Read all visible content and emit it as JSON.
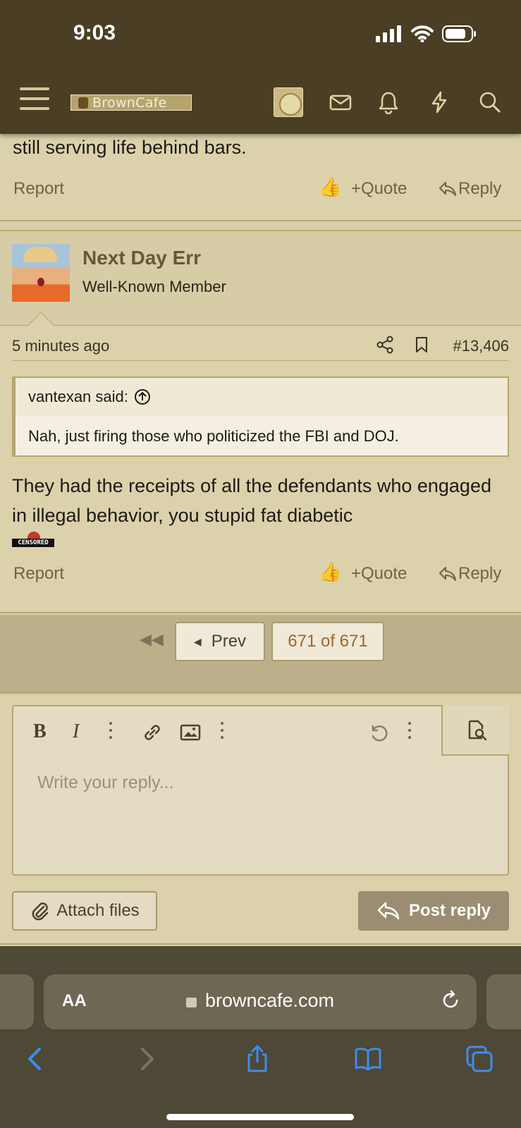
{
  "status_bar": {
    "time": "9:03"
  },
  "header": {
    "logo_text": "BrownCafe"
  },
  "prev_post": {
    "text_tail": "still serving life behind bars.",
    "report_label": "Report",
    "quote_label": "Quote",
    "reply_label": "Reply"
  },
  "post": {
    "username": "Next Day Err",
    "user_title": "Well-Known Member",
    "time": "5 minutes ago",
    "post_number": "#13,406",
    "quote": {
      "author_said": "vantexan said:",
      "body": "Nah, just firing those who politicized the FBI and DOJ."
    },
    "body": "They had the receipts of all the defendants who engaged in illegal behavior, you stupid fat diabetic",
    "censored_label": "CENSORED",
    "report_label": "Report",
    "quote_label": "Quote",
    "reply_label": "Reply"
  },
  "pager": {
    "prev_label": "Prev",
    "page_label": "671 of 671"
  },
  "editor": {
    "placeholder": "Write your reply...",
    "attach_label": "Attach files",
    "post_reply_label": "Post reply"
  },
  "browser": {
    "aa_label": "AA",
    "url": "browncafe.com"
  },
  "colors": {
    "header_bg": "#4a3f24",
    "page_bg": "#d8cfaa",
    "username": "#66583a",
    "accent_page": "#a0662a",
    "post_reply_bg": "#9b8d72",
    "browser_link": "#3d8cf0"
  }
}
